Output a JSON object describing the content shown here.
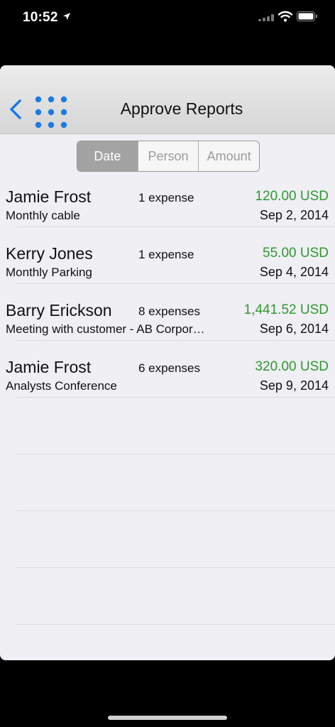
{
  "status_bar": {
    "time": "10:52",
    "icons": [
      "location-arrow-icon",
      "cellular-signal-icon",
      "wifi-icon",
      "battery-icon"
    ]
  },
  "nav": {
    "title": "Approve Reports",
    "back_icon": "chevron-left-icon",
    "menu_icon": "grid-dots-icon",
    "accent_color": "#1a7ae6"
  },
  "sort_tabs": {
    "options": [
      "Date",
      "Person",
      "Amount"
    ],
    "selected": "Date"
  },
  "colors": {
    "amount": "#2e9a2e",
    "selected_segment": "#a3a3a3"
  },
  "reports": [
    {
      "name": "Jamie Frost",
      "expenses": "1 expense",
      "description": "Monthly cable",
      "amount": "120.00 USD",
      "date": "Sep 2, 2014"
    },
    {
      "name": "Kerry Jones",
      "expenses": "1 expense",
      "description": "Monthly Parking",
      "amount": "55.00 USD",
      "date": "Sep 4, 2014"
    },
    {
      "name": "Barry Erickson",
      "expenses": "8 expenses",
      "description": "Meeting with customer - AB Corpor…",
      "amount": "1,441.52 USD",
      "date": "Sep 6, 2014"
    },
    {
      "name": "Jamie Frost",
      "expenses": "6 expenses",
      "description": "Analysts Conference",
      "amount": "320.00 USD",
      "date": "Sep 9, 2014"
    }
  ]
}
